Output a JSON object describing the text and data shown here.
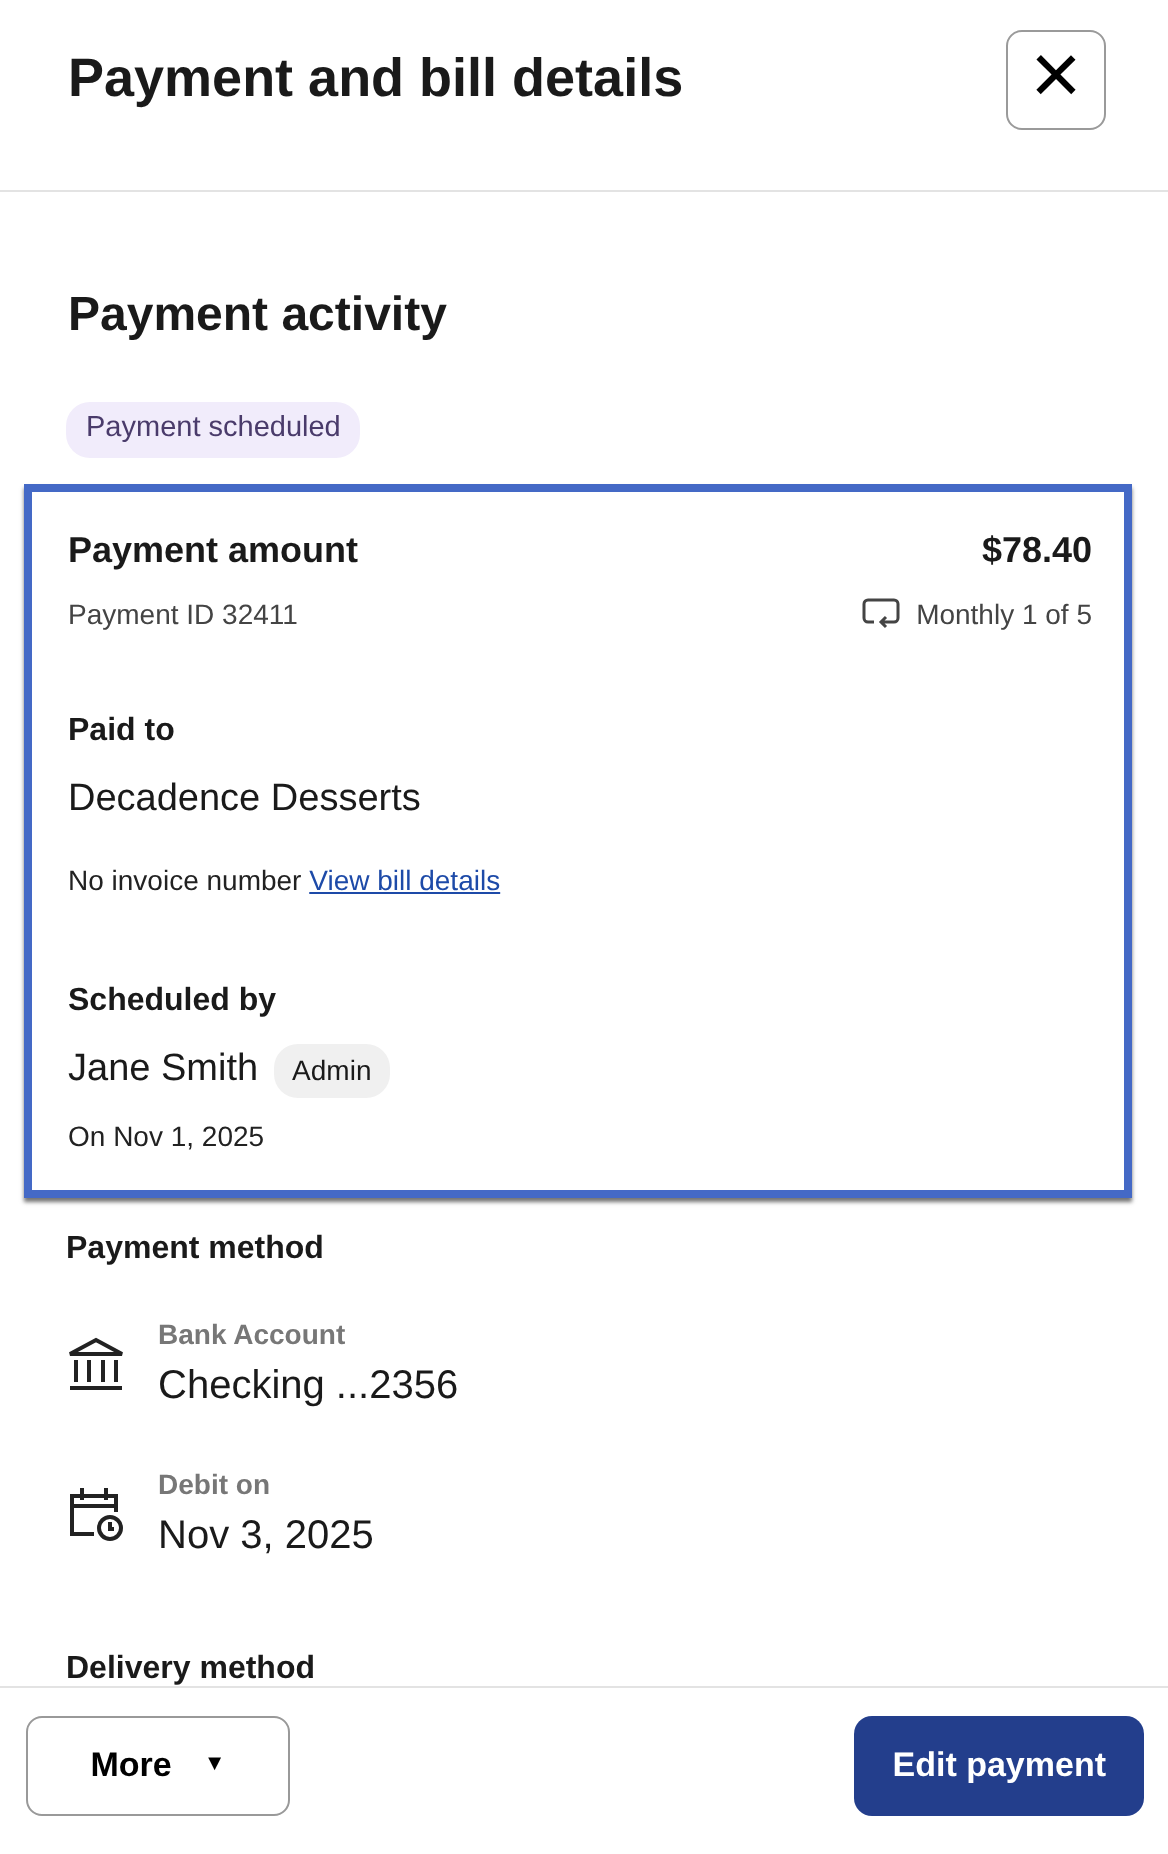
{
  "header": {
    "title": "Payment and bill details",
    "close": "×"
  },
  "activity": {
    "heading": "Payment activity",
    "status": "Payment scheduled"
  },
  "summary": {
    "amount_label": "Payment amount",
    "amount": "$78.40",
    "payment_id": "Payment ID 32411",
    "recurrence": "Monthly 1 of 5",
    "paid_to_label": "Paid to",
    "payee": "Decadence Desserts",
    "invoice": "No invoice number",
    "bill_link": "View bill details",
    "scheduled_by_label": "Scheduled by",
    "scheduler": "Jane Smith",
    "role": "Admin",
    "scheduled_on": "On Nov 1, 2025"
  },
  "payment_method": {
    "heading": "Payment method",
    "items": [
      {
        "kind": "bank",
        "label": "Bank Account",
        "value": "Checking ...2356"
      },
      {
        "kind": "date",
        "label": "Debit on",
        "value": "Nov 3, 2025"
      }
    ]
  },
  "delivery_method": {
    "heading": "Delivery method"
  },
  "footer": {
    "more": "More",
    "caret": "▼",
    "primary": "Edit payment"
  }
}
